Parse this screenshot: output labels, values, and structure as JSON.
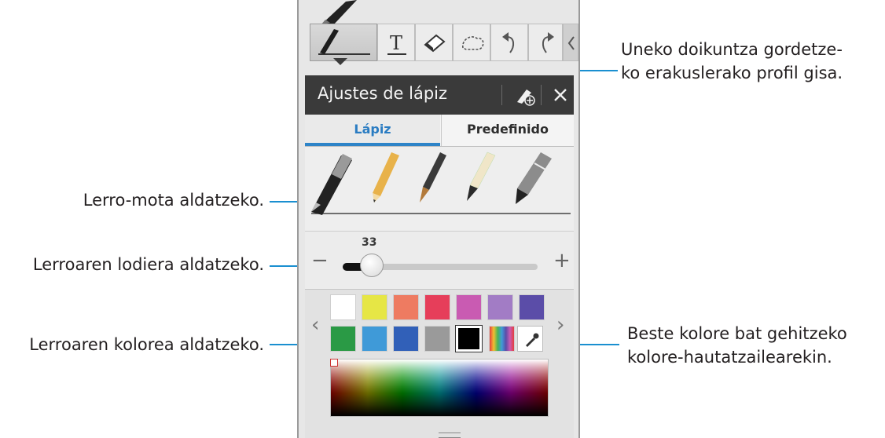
{
  "annotations": {
    "profile": "Uneko doikuntza gordetze-\nko erakuslerako profil gisa.",
    "pen_type": "Lerro-mota aldatzeko.",
    "thickness": "Lerroaren lodiera aldatzeko.",
    "color": "Lerroaren kolorea aldatzeko.",
    "picker": "Beste kolore bat gehitzeko\nkolore-hautatzailearekin."
  },
  "toolbar": {
    "icons": [
      "pen-icon",
      "text-icon",
      "eraser-icon",
      "lasso-icon",
      "undo-icon",
      "redo-icon",
      "collapse-icon"
    ],
    "text_tool_label": "T"
  },
  "panel": {
    "title": "Ajustes de lápiz",
    "tabs": [
      "Lápiz",
      "Predefinido"
    ],
    "selected_tab": "Lápiz",
    "pen_types": [
      "ballpoint",
      "pencil",
      "brush",
      "calligraphy",
      "marker"
    ],
    "selected_pen": "ballpoint",
    "size": {
      "value": "33",
      "minus": "−",
      "plus": "+"
    },
    "colors_row1": [
      "#ffffff",
      "#e6e645",
      "#ee7b61",
      "#e63e5a",
      "#c95bb2",
      "#a27cc5",
      "#5b4da8"
    ],
    "colors_row2": [
      "#2a9a45",
      "#3f9ad8",
      "#3160b8",
      "#9a9a9a",
      "#000000"
    ],
    "selected_color": "#000000",
    "nav_left": "‹",
    "nav_right": "›"
  },
  "accent_color": "#1a8fd0"
}
